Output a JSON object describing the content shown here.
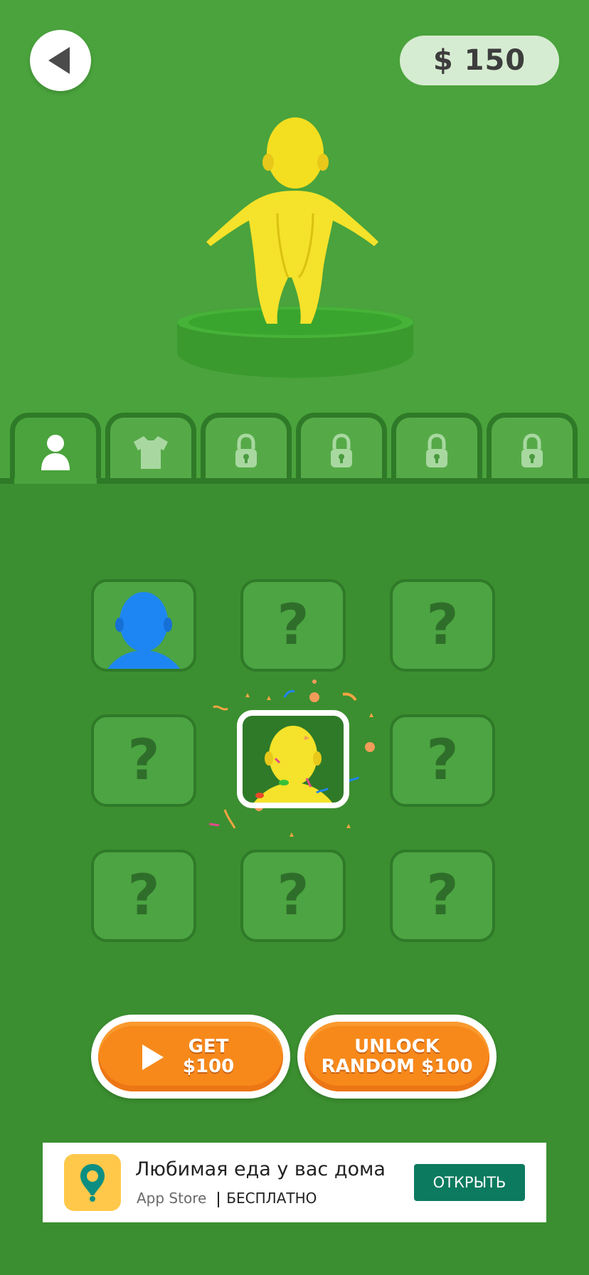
{
  "header": {
    "back_icon": "back-arrow-icon",
    "money": "$ 150"
  },
  "tabs": [
    {
      "icon": "person-icon",
      "state": "active"
    },
    {
      "icon": "shirt-icon",
      "state": "unlocked"
    },
    {
      "icon": "lock-icon",
      "state": "locked"
    },
    {
      "icon": "lock-icon",
      "state": "locked"
    },
    {
      "icon": "lock-icon",
      "state": "locked"
    },
    {
      "icon": "lock-icon",
      "state": "locked"
    }
  ],
  "grid": {
    "cells": [
      {
        "content": "blue-character",
        "state": "unlocked"
      },
      {
        "content": "?",
        "state": "locked"
      },
      {
        "content": "?",
        "state": "locked"
      },
      {
        "content": "?",
        "state": "locked"
      },
      {
        "content": "yellow-character",
        "state": "selected"
      },
      {
        "content": "?",
        "state": "locked"
      },
      {
        "content": "?",
        "state": "locked"
      },
      {
        "content": "?",
        "state": "locked"
      },
      {
        "content": "?",
        "state": "locked"
      }
    ]
  },
  "buttons": {
    "get_line1": "GET",
    "get_line2": "$100",
    "unlock_line1": "UNLOCK",
    "unlock_line2": "RANDOM $100"
  },
  "ad": {
    "title": "Любимая еда у вас дома",
    "store": "App Store",
    "price": "БЕСПЛАТНО",
    "cta": "ОТКРЫТЬ"
  },
  "colors": {
    "background_top": "#4aa33c",
    "background_bottom": "#3b8f30",
    "button_orange": "#f7891b",
    "ad_button": "#0c7a5f",
    "character_yellow": "#f5e22a",
    "character_blue": "#1e86f2"
  }
}
